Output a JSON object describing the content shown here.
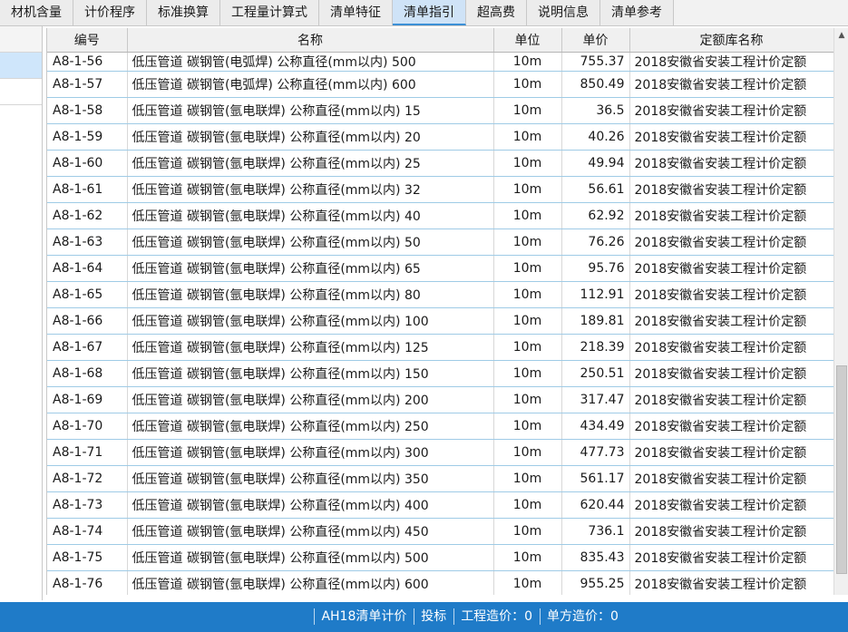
{
  "tabs": [
    {
      "label": "材机含量",
      "active": false
    },
    {
      "label": "计价程序",
      "active": false
    },
    {
      "label": "标准换算",
      "active": false
    },
    {
      "label": "工程量计算式",
      "active": false
    },
    {
      "label": "清单特征",
      "active": false
    },
    {
      "label": "清单指引",
      "active": true
    },
    {
      "label": "超高费",
      "active": false
    },
    {
      "label": "说明信息",
      "active": false
    },
    {
      "label": "清单参考",
      "active": false
    }
  ],
  "grid": {
    "headers": [
      "编号",
      "名称",
      "单位",
      "单价",
      "定额库名称"
    ],
    "rows": [
      {
        "code": "A8-1-56",
        "name": "低压管道 碳钢管(电弧焊) 公称直径(mm以内) 500",
        "unit": "10m",
        "price": "755.37",
        "lib": "2018安徽省安装工程计价定额"
      },
      {
        "code": "A8-1-57",
        "name": "低压管道 碳钢管(电弧焊) 公称直径(mm以内) 600",
        "unit": "10m",
        "price": "850.49",
        "lib": "2018安徽省安装工程计价定额"
      },
      {
        "code": "A8-1-58",
        "name": "低压管道 碳钢管(氩电联焊) 公称直径(mm以内) 15",
        "unit": "10m",
        "price": "36.5",
        "lib": "2018安徽省安装工程计价定额"
      },
      {
        "code": "A8-1-59",
        "name": "低压管道 碳钢管(氩电联焊) 公称直径(mm以内) 20",
        "unit": "10m",
        "price": "40.26",
        "lib": "2018安徽省安装工程计价定额"
      },
      {
        "code": "A8-1-60",
        "name": "低压管道 碳钢管(氩电联焊) 公称直径(mm以内) 25",
        "unit": "10m",
        "price": "49.94",
        "lib": "2018安徽省安装工程计价定额"
      },
      {
        "code": "A8-1-61",
        "name": "低压管道 碳钢管(氩电联焊) 公称直径(mm以内) 32",
        "unit": "10m",
        "price": "56.61",
        "lib": "2018安徽省安装工程计价定额"
      },
      {
        "code": "A8-1-62",
        "name": "低压管道 碳钢管(氩电联焊) 公称直径(mm以内) 40",
        "unit": "10m",
        "price": "62.92",
        "lib": "2018安徽省安装工程计价定额"
      },
      {
        "code": "A8-1-63",
        "name": "低压管道 碳钢管(氩电联焊) 公称直径(mm以内) 50",
        "unit": "10m",
        "price": "76.26",
        "lib": "2018安徽省安装工程计价定额"
      },
      {
        "code": "A8-1-64",
        "name": "低压管道 碳钢管(氩电联焊) 公称直径(mm以内) 65",
        "unit": "10m",
        "price": "95.76",
        "lib": "2018安徽省安装工程计价定额"
      },
      {
        "code": "A8-1-65",
        "name": "低压管道 碳钢管(氩电联焊) 公称直径(mm以内) 80",
        "unit": "10m",
        "price": "112.91",
        "lib": "2018安徽省安装工程计价定额"
      },
      {
        "code": "A8-1-66",
        "name": "低压管道 碳钢管(氩电联焊) 公称直径(mm以内) 100",
        "unit": "10m",
        "price": "189.81",
        "lib": "2018安徽省安装工程计价定额"
      },
      {
        "code": "A8-1-67",
        "name": "低压管道 碳钢管(氩电联焊) 公称直径(mm以内) 125",
        "unit": "10m",
        "price": "218.39",
        "lib": "2018安徽省安装工程计价定额"
      },
      {
        "code": "A8-1-68",
        "name": "低压管道 碳钢管(氩电联焊) 公称直径(mm以内) 150",
        "unit": "10m",
        "price": "250.51",
        "lib": "2018安徽省安装工程计价定额"
      },
      {
        "code": "A8-1-69",
        "name": "低压管道 碳钢管(氩电联焊) 公称直径(mm以内) 200",
        "unit": "10m",
        "price": "317.47",
        "lib": "2018安徽省安装工程计价定额"
      },
      {
        "code": "A8-1-70",
        "name": "低压管道 碳钢管(氩电联焊) 公称直径(mm以内) 250",
        "unit": "10m",
        "price": "434.49",
        "lib": "2018安徽省安装工程计价定额"
      },
      {
        "code": "A8-1-71",
        "name": "低压管道 碳钢管(氩电联焊) 公称直径(mm以内) 300",
        "unit": "10m",
        "price": "477.73",
        "lib": "2018安徽省安装工程计价定额"
      },
      {
        "code": "A8-1-72",
        "name": "低压管道 碳钢管(氩电联焊) 公称直径(mm以内) 350",
        "unit": "10m",
        "price": "561.17",
        "lib": "2018安徽省安装工程计价定额"
      },
      {
        "code": "A8-1-73",
        "name": "低压管道 碳钢管(氩电联焊) 公称直径(mm以内) 400",
        "unit": "10m",
        "price": "620.44",
        "lib": "2018安徽省安装工程计价定额"
      },
      {
        "code": "A8-1-74",
        "name": "低压管道 碳钢管(氩电联焊) 公称直径(mm以内) 450",
        "unit": "10m",
        "price": "736.1",
        "lib": "2018安徽省安装工程计价定额"
      },
      {
        "code": "A8-1-75",
        "name": "低压管道 碳钢管(氩电联焊) 公称直径(mm以内) 500",
        "unit": "10m",
        "price": "835.43",
        "lib": "2018安徽省安装工程计价定额"
      },
      {
        "code": "A8-1-76",
        "name": "低压管道 碳钢管(氩电联焊) 公称直径(mm以内) 600",
        "unit": "10m",
        "price": "955.25",
        "lib": "2018安徽省安装工程计价定额"
      }
    ]
  },
  "status": {
    "items": [
      "AH18清单计价",
      "投标",
      "工程造价：0",
      "单方造价：0"
    ]
  },
  "colors": {
    "accent": "#1f7bc8",
    "active_tab": "#cfe3f7",
    "row_border": "#9fcbe6"
  },
  "icons": {
    "scroll_up": "chevron-up-icon",
    "scroll_down": "chevron-down-icon"
  }
}
